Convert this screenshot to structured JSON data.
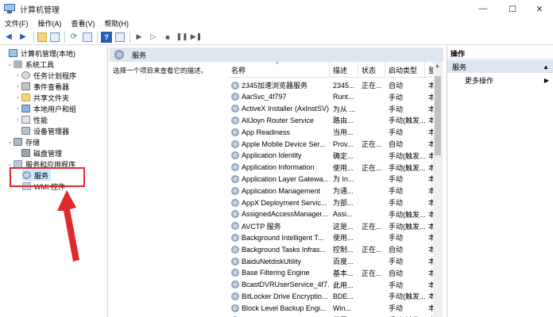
{
  "window": {
    "title": "计算机管理",
    "controls": {
      "minimize": "—",
      "maximize": "☐",
      "close": "✕"
    }
  },
  "menu": [
    "文件(F)",
    "操作(A)",
    "查看(V)",
    "帮助(H)"
  ],
  "toolbar": [
    "back-arrow-icon",
    "forward-arrow-icon",
    "folder-icon",
    "console-icon",
    "refresh-icon",
    "export-icon",
    "help-icon",
    "properties-icon",
    "play-icon",
    "play-alt-icon",
    "stop-icon",
    "pause-icon",
    "restart-icon"
  ],
  "tree": {
    "root": "计算机管理(本地)",
    "system_tools": "系统工具",
    "task_scheduler": "任务计划程序",
    "event_viewer": "事件查看器",
    "shared_folders": "共享文件夹",
    "local_users": "本地用户和组",
    "performance": "性能",
    "device_manager": "设备管理器",
    "storage": "存储",
    "disk_management": "磁盘管理",
    "services_apps": "服务和应用程序",
    "services": "服务",
    "wmi": "WMI 控件"
  },
  "center": {
    "header": "服务",
    "description": "选择一个项目来查看它的描述。"
  },
  "columns": {
    "name": "名称",
    "desc": "描述",
    "state": "状态",
    "start": "启动类型",
    "logon": "登"
  },
  "services": [
    {
      "name": "2345加速浏览器服务",
      "desc": "2345...",
      "state": "正在...",
      "start": "自动",
      "logon": "本"
    },
    {
      "name": "AarSvc_4f797",
      "desc": "Runt...",
      "state": "",
      "start": "手动",
      "logon": "本"
    },
    {
      "name": "ActiveX Installer (AxInstSV)",
      "desc": "为从 ...",
      "state": "",
      "start": "手动",
      "logon": "本"
    },
    {
      "name": "AllJoyn Router Service",
      "desc": "路由...",
      "state": "",
      "start": "手动(触发...",
      "logon": "本"
    },
    {
      "name": "App Readiness",
      "desc": "当用...",
      "state": "",
      "start": "手动",
      "logon": "本"
    },
    {
      "name": "Apple Mobile Device Ser...",
      "desc": "Prov...",
      "state": "正在...",
      "start": "自动",
      "logon": "本"
    },
    {
      "name": "Application Identity",
      "desc": "确定...",
      "state": "",
      "start": "手动(触发...",
      "logon": "本"
    },
    {
      "name": "Application Information",
      "desc": "使用...",
      "state": "正在...",
      "start": "手动(触发...",
      "logon": "本"
    },
    {
      "name": "Application Layer Gatewa...",
      "desc": "为 In...",
      "state": "",
      "start": "手动",
      "logon": "本"
    },
    {
      "name": "Application Management",
      "desc": "为通...",
      "state": "",
      "start": "手动",
      "logon": "本"
    },
    {
      "name": "AppX Deployment Servic...",
      "desc": "为部...",
      "state": "",
      "start": "手动",
      "logon": "本"
    },
    {
      "name": "AssignedAccessManager...",
      "desc": "Assi...",
      "state": "",
      "start": "手动(触发...",
      "logon": "本"
    },
    {
      "name": "AVCTP 服务",
      "desc": "这是...",
      "state": "正在...",
      "start": "手动(触发...",
      "logon": "本"
    },
    {
      "name": "Background Intelligent T...",
      "desc": "使用...",
      "state": "",
      "start": "手动",
      "logon": "本"
    },
    {
      "name": "Background Tasks Infras...",
      "desc": "控制...",
      "state": "正在...",
      "start": "自动",
      "logon": "本"
    },
    {
      "name": "BaiduNetdiskUtility",
      "desc": "百度...",
      "state": "",
      "start": "手动",
      "logon": "本"
    },
    {
      "name": "Base Filtering Engine",
      "desc": "基本...",
      "state": "正在...",
      "start": "自动",
      "logon": "本"
    },
    {
      "name": "BcastDVRUserService_4f7...",
      "desc": "此用...",
      "state": "",
      "start": "手动",
      "logon": "本"
    },
    {
      "name": "BitLocker Drive Encryptio...",
      "desc": "BDE...",
      "state": "",
      "start": "手动(触发...",
      "logon": "本"
    },
    {
      "name": "Block Level Backup Engi...",
      "desc": "Win...",
      "state": "",
      "start": "手动",
      "logon": "本"
    },
    {
      "name": "BluetoothUserService_4f...",
      "desc": "蓝牙...",
      "state": "",
      "start": "手动(触发...",
      "logon": "本"
    }
  ],
  "actions": {
    "header": "操作",
    "section": "服务",
    "more": "更多操作"
  },
  "colors": {
    "highlight_red": "#e02a2a",
    "header_bg": "#dde6f1",
    "selection": "#cde8ff"
  }
}
